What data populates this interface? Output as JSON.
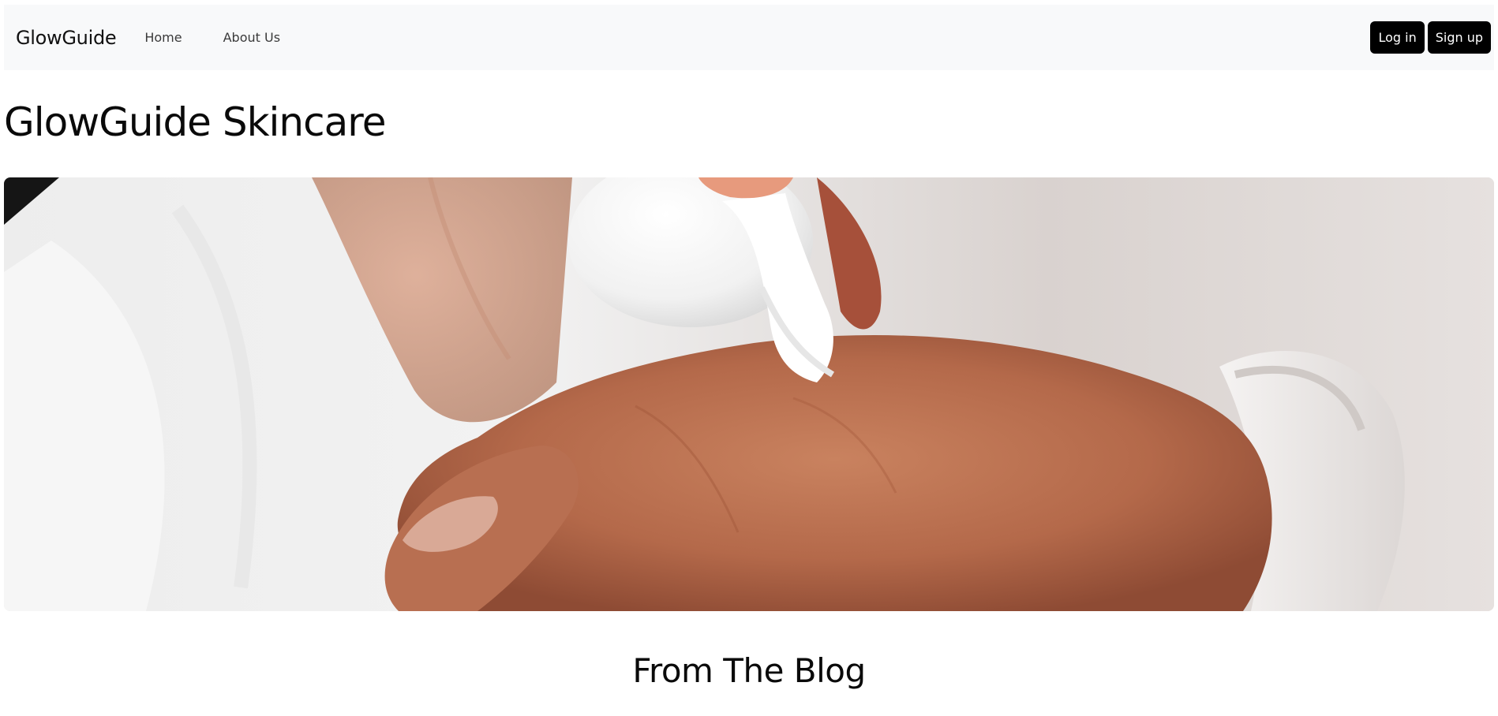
{
  "navbar": {
    "brand": "GlowGuide",
    "links": [
      {
        "label": "Home"
      },
      {
        "label": "About Us"
      }
    ],
    "login_label": "Log in",
    "signup_label": "Sign up"
  },
  "hero": {
    "title": "GlowGuide Skincare"
  },
  "blog": {
    "title": "From The Blog"
  },
  "colors": {
    "navbar_bg": "#f8f9fa",
    "button_bg": "#000000",
    "button_text": "#ffffff"
  }
}
